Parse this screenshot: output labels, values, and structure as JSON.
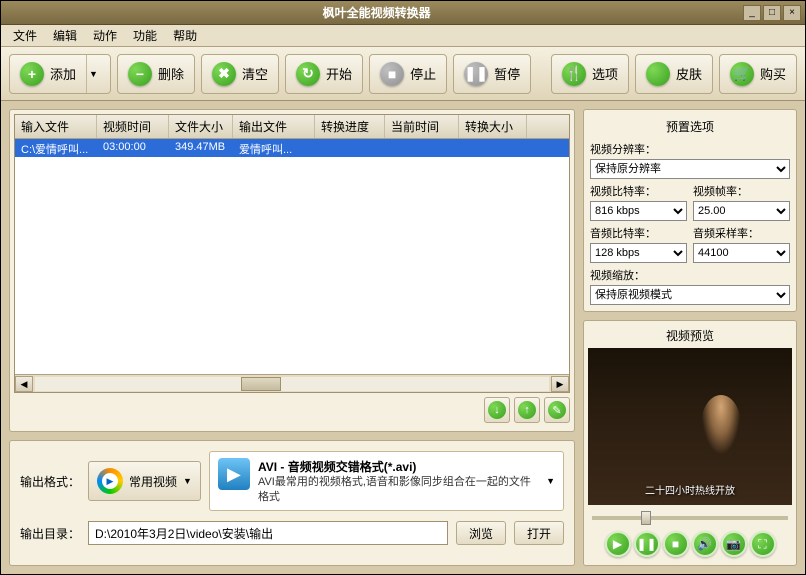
{
  "window": {
    "title": "枫叶全能视频转换器"
  },
  "menu": [
    "文件",
    "编辑",
    "动作",
    "功能",
    "帮助"
  ],
  "toolbar": {
    "add": "添加",
    "delete": "删除",
    "clear": "清空",
    "start": "开始",
    "stop": "停止",
    "pause": "暂停",
    "options": "选项",
    "skin": "皮肤",
    "buy": "购买"
  },
  "table": {
    "headers": [
      "输入文件",
      "视频时间",
      "文件大小",
      "输出文件",
      "转换进度",
      "当前时间",
      "转换大小"
    ],
    "rows": [
      {
        "cells": [
          "C:\\爱情呼叫...",
          "03:00:00",
          "349.47MB",
          "爱情呼叫...",
          "",
          "",
          ""
        ],
        "selected": true
      }
    ]
  },
  "output": {
    "format_label": "输出格式：",
    "format_category": "常用视频",
    "format_title": "AVI - 音频视频交错格式(*.avi)",
    "format_desc": "AVI最常用的视频格式,语音和影像同步组合在一起的文件格式",
    "dir_label": "输出目录：",
    "dir_value": "D:\\2010年3月2日\\video\\安装\\输出",
    "browse": "浏览",
    "open": "打开"
  },
  "preset": {
    "title": "预置选项",
    "resolution_label": "视频分辨率：",
    "resolution": "保持原分辨率",
    "vbitrate_label": "视频比特率：",
    "vbitrate": "816 kbps",
    "framerate_label": "视频帧率：",
    "framerate": "25.00",
    "abitrate_label": "音频比特率：",
    "abitrate": "128 kbps",
    "samplerate_label": "音频采样率：",
    "samplerate": "44100",
    "zoom_label": "视频缩放：",
    "zoom": "保持原视频模式"
  },
  "preview": {
    "title": "视频预览",
    "caption": "二十四小时热线开放"
  }
}
